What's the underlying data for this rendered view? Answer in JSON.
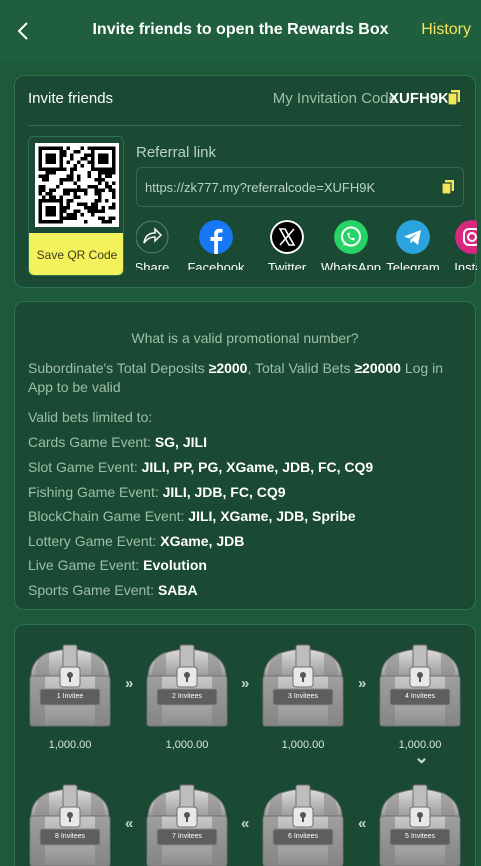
{
  "header": {
    "title": "Invite friends to open the Rewards Box",
    "history_label": "History",
    "back_icon": "chevron-left-icon"
  },
  "invite": {
    "title": "Invite friends",
    "code_label": "My Invitation Code",
    "code": "XUFH9K",
    "save_qr_label": "Save QR Code",
    "referral_label": "Referral link",
    "referral_url": "https://zk777.my?referralcode=XUFH9K",
    "shares": [
      {
        "label": "Share",
        "icon": "share-arrow-icon"
      },
      {
        "label": "Facebook",
        "icon": "facebook-icon"
      },
      {
        "label": "Twitter",
        "icon": "twitter-x-icon"
      },
      {
        "label": "WhatsApp",
        "icon": "whatsapp-icon"
      },
      {
        "label": "Telegram",
        "icon": "telegram-icon"
      },
      {
        "label": "Instag",
        "icon": "instagram-icon"
      }
    ]
  },
  "rules": {
    "question": "What is a valid promotional number?",
    "req_prefix": "Subordinate's Total Deposits",
    "req_deposit": "≥2000",
    "req_mid": ", Total Valid Bets",
    "req_bets": "≥20000",
    "req_suffix": " Log in",
    "req_line2": "App to be valid",
    "limited_title": "Valid bets limited to:",
    "events": [
      {
        "name": "Cards Game Event:",
        "value": "SG, JILI"
      },
      {
        "name": "Slot Game Event:",
        "value": "JILI, PP, PG, XGame, JDB, FC, CQ9"
      },
      {
        "name": "Fishing Game Event:",
        "value": "JILI, JDB, FC, CQ9"
      },
      {
        "name": "BlockChain Game Event:",
        "value": "JILI, XGame, JDB, Spribe"
      },
      {
        "name": "Lottery Game Event:",
        "value": "XGame, JDB"
      },
      {
        "name": "Live Game Event:",
        "value": "Evolution"
      },
      {
        "name": "Sports Game Event:",
        "value": "SABA"
      }
    ]
  },
  "rewards": {
    "row1": [
      {
        "label": "1 Invitee",
        "amount": "1,000.00"
      },
      {
        "label": "2 Invitees",
        "amount": "1,000.00"
      },
      {
        "label": "3 Invitees",
        "amount": "1,000.00"
      },
      {
        "label": "4 Invitees",
        "amount": "1,000.00"
      }
    ],
    "row2": [
      {
        "label": "8 Invitees"
      },
      {
        "label": "7 Invitees"
      },
      {
        "label": "6 Invitees"
      },
      {
        "label": "5 Invitees"
      }
    ],
    "arrow_right": "»",
    "arrow_left": "«",
    "arrow_down": "⌄"
  },
  "colors": {
    "background": "#1d5a3a",
    "card": "#1a4a33",
    "accent_yellow": "#f4e55a",
    "qr_button": "#f4f25c"
  }
}
